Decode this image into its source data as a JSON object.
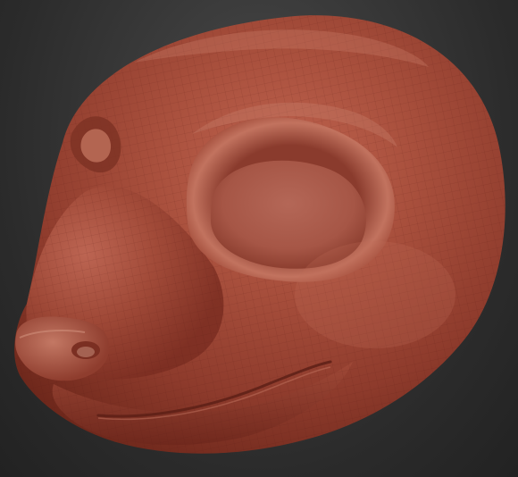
{
  "viewport": {
    "background_color": "#2b2b2b",
    "model": {
      "subject": "stylized-animal-head-sculpt",
      "material_color": "#a84a3a",
      "wireframe_visible": true
    }
  }
}
